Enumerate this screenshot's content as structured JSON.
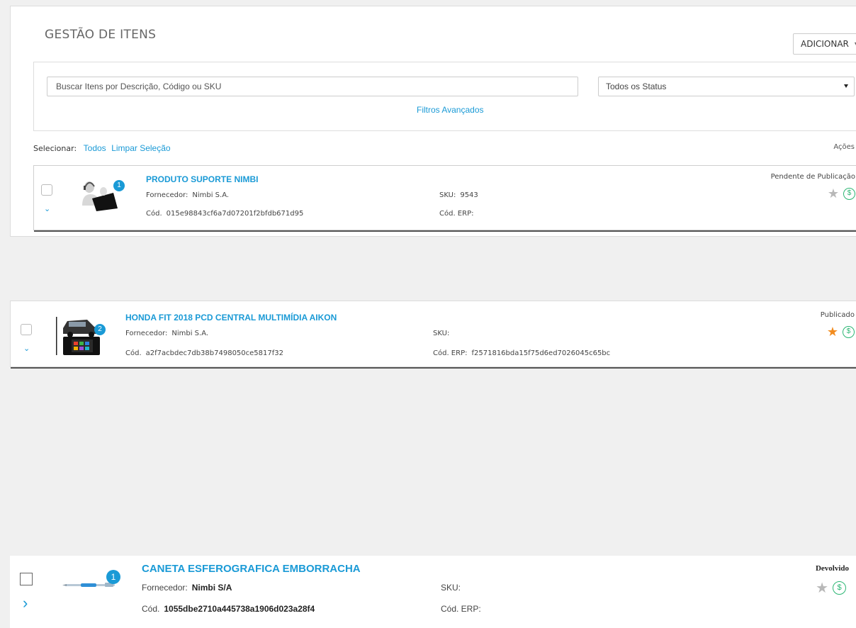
{
  "header": {
    "title": "GESTÃO DE ITENS",
    "add_button": "ADICIONAR"
  },
  "filters": {
    "search_placeholder": "Buscar Itens por Descrição, Código ou SKU",
    "status_selected": "Todos os Status",
    "advanced_link": "Filtros Avançados"
  },
  "selection": {
    "label": "Selecionar:",
    "all": "Todos",
    "clear": "Limpar Seleção",
    "actions": "Ações"
  },
  "items": [
    {
      "title": "PRODUTO SUPORTE NIMBI",
      "badge": "1",
      "supplier_label": "Fornecedor:",
      "supplier": "Nimbi S.A.",
      "code_label": "Cód.",
      "code": "015e98843cf6a7d07201f2bfdb671d95",
      "sku_label": "SKU:",
      "sku": "9543",
      "erp_label": "Cód. ERP:",
      "erp": "",
      "status": "Pendente de Publicação",
      "starred": false
    },
    {
      "title": "HONDA FIT 2018 PCD CENTRAL MULTIMÍDIA AIKON",
      "badge": "2",
      "supplier_label": "Fornecedor:",
      "supplier": "Nimbi S.A.",
      "code_label": "Cód.",
      "code": "a2f7acbdec7db38b7498050ce5817f32",
      "sku_label": "SKU:",
      "sku": "",
      "erp_label": "Cód. ERP:",
      "erp": "f2571816bda15f75d6ed7026045c65bc",
      "status": "Publicado",
      "starred": true
    },
    {
      "title": "CANETA ESFEROGRAFICA EMBORRACHA",
      "badge": "1",
      "supplier_label": "Fornecedor:",
      "supplier": "Nimbi S/A",
      "code_label": "Cód.",
      "code": "1055dbe2710a445738a1906d023a28f4",
      "sku_label": "SKU:",
      "sku": "",
      "erp_label": "Cód. ERP:",
      "erp": "",
      "status": "Devolvido",
      "starred": false
    }
  ],
  "icons": {
    "dollar_glyph": "$",
    "star_glyph": "★",
    "chevron_down_glyph": "⌄",
    "chevron_right_glyph": "›"
  },
  "colors": {
    "accent": "#1a9ad6",
    "star_active": "#f28c1f",
    "star_inactive": "#b8b8b8",
    "money": "#2bb673"
  }
}
